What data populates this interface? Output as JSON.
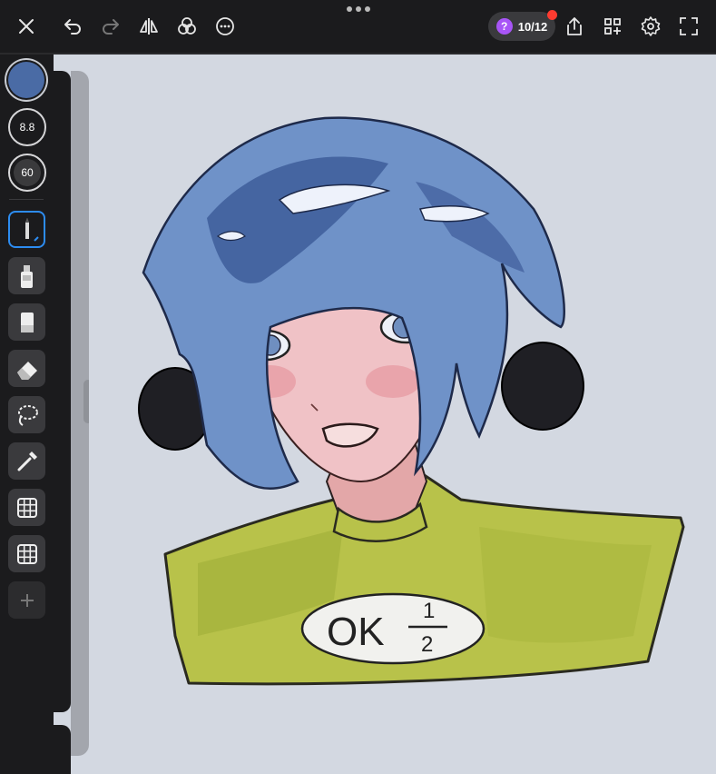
{
  "toolbar": {
    "help_counter": "10/12",
    "help_symbol": "?",
    "icons": [
      "close-icon",
      "undo-icon",
      "redo-icon",
      "symmetry-icon",
      "color-blend-icon",
      "more-icon",
      "share-icon",
      "add-widget-icon",
      "settings-icon",
      "fullscreen-icon"
    ]
  },
  "sidebar": {
    "current_color": "#4a6ba5",
    "brush_size": "8.8",
    "brush_opacity": "60",
    "tools": [
      "pencil-tool",
      "spray-tool",
      "marker-tool",
      "eraser-tool",
      "lasso-tool",
      "eyedropper-tool",
      "grid-tool",
      "grid-tool-2",
      "add-tool"
    ]
  },
  "canvas": {
    "shirt_text_main": "OK",
    "shirt_text_num": "1",
    "shirt_text_den": "2"
  },
  "colors": {
    "chrome": "#1b1b1d",
    "canvas_bg": "#d3d8e1",
    "accent": "#2d8cf0",
    "help_badge": "#a855f7",
    "notification": "#ff3b30"
  }
}
